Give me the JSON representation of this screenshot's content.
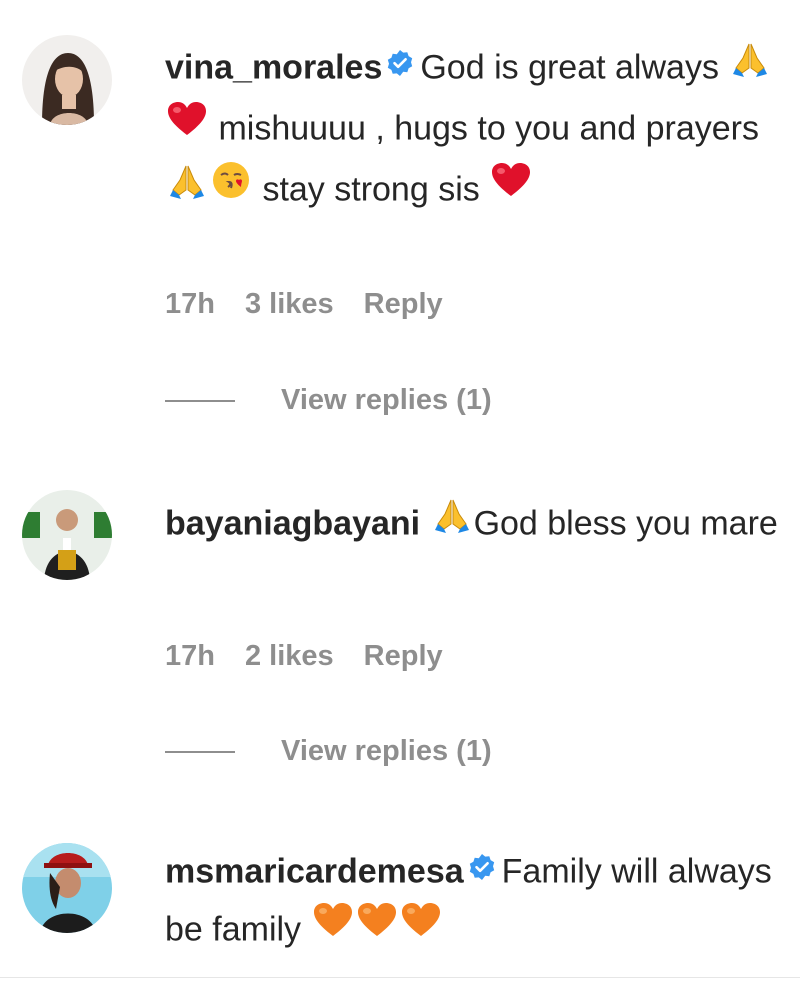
{
  "comments": [
    {
      "username": "vina_morales",
      "verified": true,
      "segments": [
        {
          "text": "God is great always "
        },
        {
          "emoji": "folded-hands"
        },
        {
          "emoji": "red-heart"
        },
        {
          "text": " mishuuuu , hugs to you and prayers "
        },
        {
          "emoji": "folded-hands"
        },
        {
          "emoji": "face-blowing-kiss"
        },
        {
          "text": " stay strong sis "
        },
        {
          "emoji": "red-heart"
        }
      ],
      "time": "17h",
      "likes": "3 likes",
      "reply_label": "Reply",
      "view_replies": "View replies (1)"
    },
    {
      "username": "bayaniagbayani",
      "verified": false,
      "segments": [
        {
          "emoji": "folded-hands"
        },
        {
          "text": "God bless you mare"
        }
      ],
      "time": "17h",
      "likes": "2 likes",
      "reply_label": "Reply",
      "view_replies": "View replies (1)"
    },
    {
      "username": "msmaricardemesa",
      "verified": true,
      "segments": [
        {
          "text": "Family will always be family "
        },
        {
          "emoji": "orange-heart"
        },
        {
          "emoji": "orange-heart"
        },
        {
          "emoji": "orange-heart"
        }
      ]
    }
  ],
  "colors": {
    "text": "#262626",
    "secondary": "#8e8e8e",
    "verified": "#3897f0",
    "heart_red": "#e0112b",
    "heart_orange": "#f4801f",
    "emoji_yellow": "#fbc02d"
  }
}
